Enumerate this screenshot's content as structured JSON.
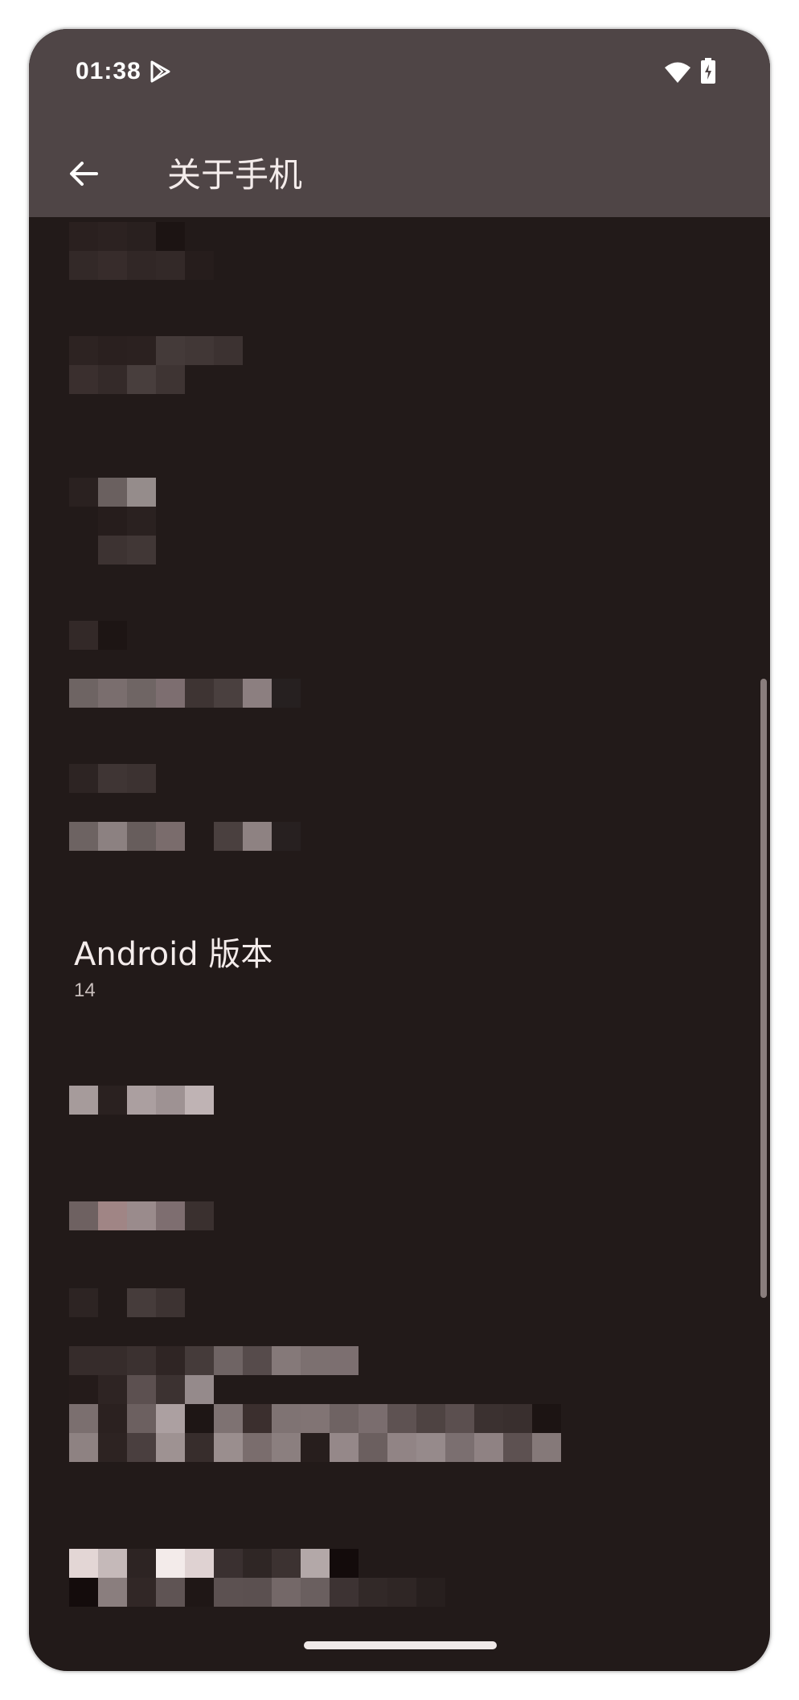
{
  "status_bar": {
    "time": "01:38",
    "icons": [
      "play-store-icon",
      "wifi-icon",
      "battery-charging-icon"
    ]
  },
  "app_bar": {
    "back_icon": "arrow-left-icon",
    "title": "关于手机"
  },
  "items": [
    {
      "title": "Android 版本",
      "value": "14"
    }
  ],
  "colors": {
    "app_bar": "#4f4546",
    "background": "#221a19",
    "title_text": "#f4eceb",
    "value_text": "#c9bfbd"
  }
}
